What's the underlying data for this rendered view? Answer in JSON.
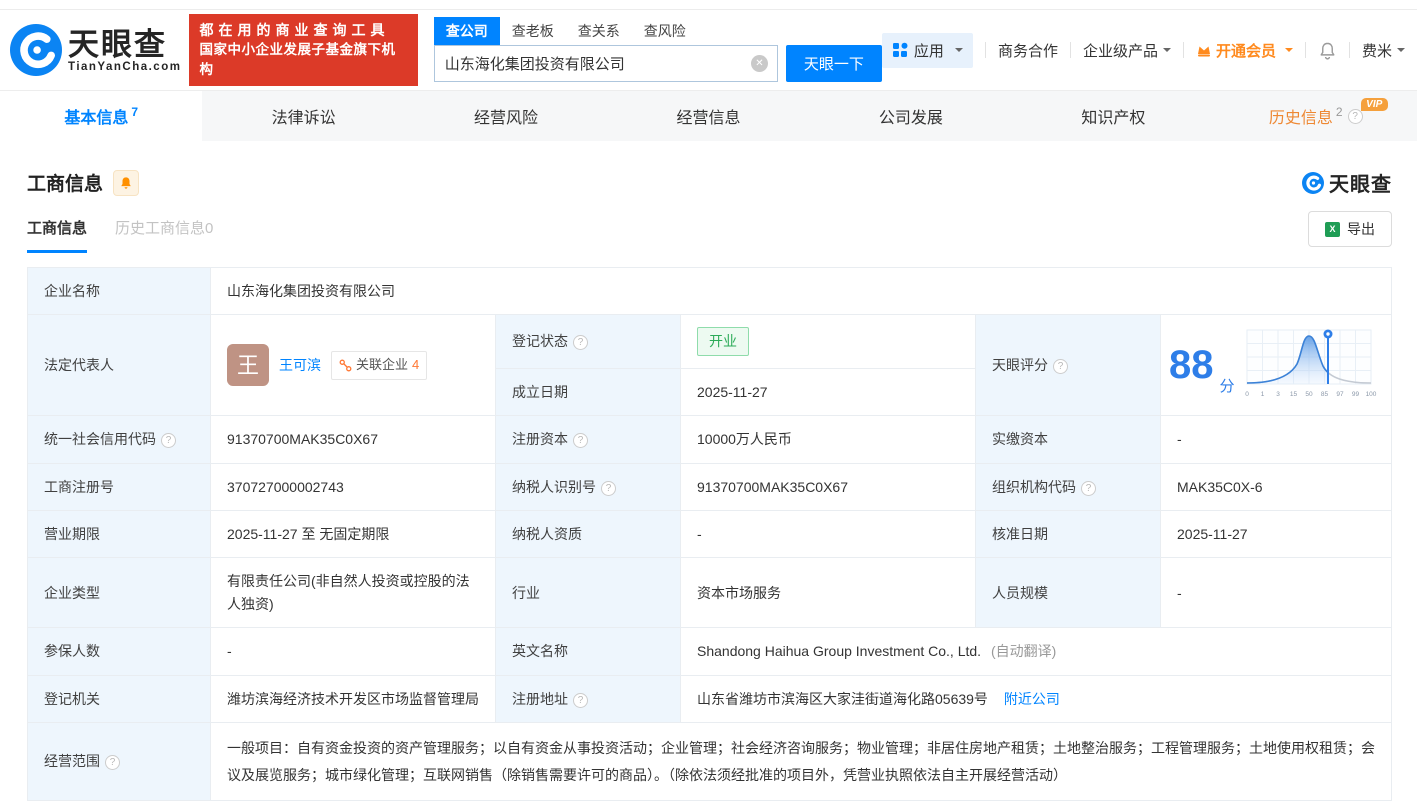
{
  "brand": {
    "name": "天眼查",
    "domain": "TianYanCha.com",
    "slogan_line1": "都在用的商业查询工具",
    "slogan_line2": "国家中小企业发展子基金旗下机构",
    "primary_color": "#0084ff",
    "slogan_bg": "#dc3a28"
  },
  "search": {
    "tabs": [
      {
        "label": "查公司",
        "active": true
      },
      {
        "label": "查老板",
        "active": false
      },
      {
        "label": "查关系",
        "active": false
      },
      {
        "label": "查风险",
        "active": false
      }
    ],
    "value": "山东海化集团投资有限公司",
    "button": "天眼一下"
  },
  "topnav": {
    "apps": "应用",
    "biz": "商务合作",
    "enterprise": "企业级产品",
    "vip": "开通会员",
    "user": "费米"
  },
  "main_tabs": [
    {
      "label": "基本信息",
      "count": "7",
      "active": true
    },
    {
      "label": "法律诉讼"
    },
    {
      "label": "经营风险"
    },
    {
      "label": "经营信息"
    },
    {
      "label": "公司发展"
    },
    {
      "label": "知识产权"
    },
    {
      "label": "历史信息",
      "count": "2",
      "vip": "VIP"
    }
  ],
  "section": {
    "title": "工商信息",
    "subtabs": [
      {
        "label": "工商信息",
        "active": true
      },
      {
        "label": "历史工商信息0",
        "active": false
      }
    ],
    "export_label": "导出",
    "watermark": "天眼查"
  },
  "fields": {
    "company_name": {
      "label": "企业名称",
      "value": "山东海化集团投资有限公司"
    },
    "legal_rep": {
      "label": "法定代表人",
      "name": "王可滨",
      "avatar_char": "王",
      "related_label": "关联企业",
      "related_count": "4"
    },
    "reg_status": {
      "label": "登记状态",
      "value": "开业",
      "status_color": "#2bab58"
    },
    "establish_date": {
      "label": "成立日期",
      "value": "2025-11-27"
    },
    "credit_code": {
      "label": "统一社会信用代码",
      "value": "91370700MAK35C0X67"
    },
    "reg_capital": {
      "label": "注册资本",
      "value": "10000万人民币"
    },
    "paid_capital": {
      "label": "实缴资本",
      "value": "-"
    },
    "reg_number": {
      "label": "工商注册号",
      "value": "370727000002743"
    },
    "taxpayer_id": {
      "label": "纳税人识别号",
      "value": "91370700MAK35C0X67"
    },
    "org_code": {
      "label": "组织机构代码",
      "value": "MAK35C0X-6"
    },
    "business_term": {
      "label": "营业期限",
      "value": "2025-11-27 至 无固定期限"
    },
    "taxpayer_quality": {
      "label": "纳税人资质",
      "value": "-"
    },
    "approval_date": {
      "label": "核准日期",
      "value": "2025-11-27"
    },
    "company_type": {
      "label": "企业类型",
      "value": "有限责任公司(非自然人投资或控股的法人独资)"
    },
    "industry": {
      "label": "行业",
      "value": "资本市场服务"
    },
    "staff_size": {
      "label": "人员规模",
      "value": "-"
    },
    "insured_count": {
      "label": "参保人数",
      "value": "-"
    },
    "english_name": {
      "label": "英文名称",
      "value": "Shandong Haihua Group Investment Co., Ltd.",
      "note": "(自动翻译)"
    },
    "reg_authority": {
      "label": "登记机关",
      "value": "潍坊滨海经济技术开发区市场监督管理局"
    },
    "reg_address": {
      "label": "注册地址",
      "value": "山东省潍坊市滨海区大家洼街道海化路05639号",
      "link": "附近公司"
    },
    "business_scope": {
      "label": "经营范围",
      "value": "一般项目：自有资金投资的资产管理服务；以自有资金从事投资活动；企业管理；社会经济咨询服务；物业管理；非居住房地产租赁；土地整治服务；工程管理服务；土地使用权租赁；会议及展览服务；城市绿化管理；互联网销售（除销售需要许可的商品）。（除依法须经批准的项目外，凭营业执照依法自主开展经营活动）"
    }
  },
  "score": {
    "label": "天眼评分",
    "value": "88",
    "unit": "分",
    "marker_value": 88,
    "ticks": [
      "0",
      "1",
      "3",
      "15",
      "50",
      "85",
      "97",
      "99",
      "100"
    ],
    "curve_color": "#3b82d8",
    "number_color": "#2e7ee8"
  }
}
